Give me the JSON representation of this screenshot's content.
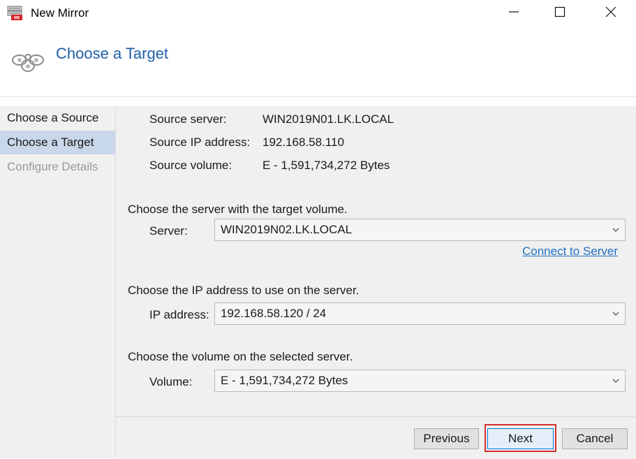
{
  "window": {
    "title": "New Mirror",
    "icons": {
      "app": "mirror-app-icon",
      "minimize": "minimize-icon",
      "maximize": "maximize-icon",
      "close": "close-icon"
    }
  },
  "header": {
    "title": "Choose a Target",
    "icon": "mirror-wizard-icon"
  },
  "sidebar": {
    "items": [
      {
        "label": "Choose a Source",
        "state": "normal"
      },
      {
        "label": "Choose a Target",
        "state": "active"
      },
      {
        "label": "Configure Details",
        "state": "disabled"
      }
    ]
  },
  "source": {
    "server_label": "Source server:",
    "server_value": "WIN2019N01.LK.LOCAL",
    "ip_label": "Source IP address:",
    "ip_value": "192.168.58.110",
    "volume_label": "Source volume:",
    "volume_value": "E - 1,591,734,272 Bytes"
  },
  "server_section": {
    "heading": "Choose the server with the target volume.",
    "label": "Server:",
    "selected": "WIN2019N02.LK.LOCAL",
    "connect_link": "Connect to Server"
  },
  "ip_section": {
    "heading": "Choose the IP address to use on the server.",
    "label": "IP address:",
    "selected": "192.168.58.120 / 24"
  },
  "volume_section": {
    "heading": "Choose the volume on the selected server.",
    "label": "Volume:",
    "selected": "E - 1,591,734,272 Bytes"
  },
  "footer": {
    "previous_label": "Previous",
    "next_label": "Next",
    "cancel_label": "Cancel"
  },
  "colors": {
    "accent": "#1f5fa8",
    "link": "#1f6fbf",
    "sidebar_active": "#c9d7ea",
    "highlight": "#d32f2f"
  }
}
